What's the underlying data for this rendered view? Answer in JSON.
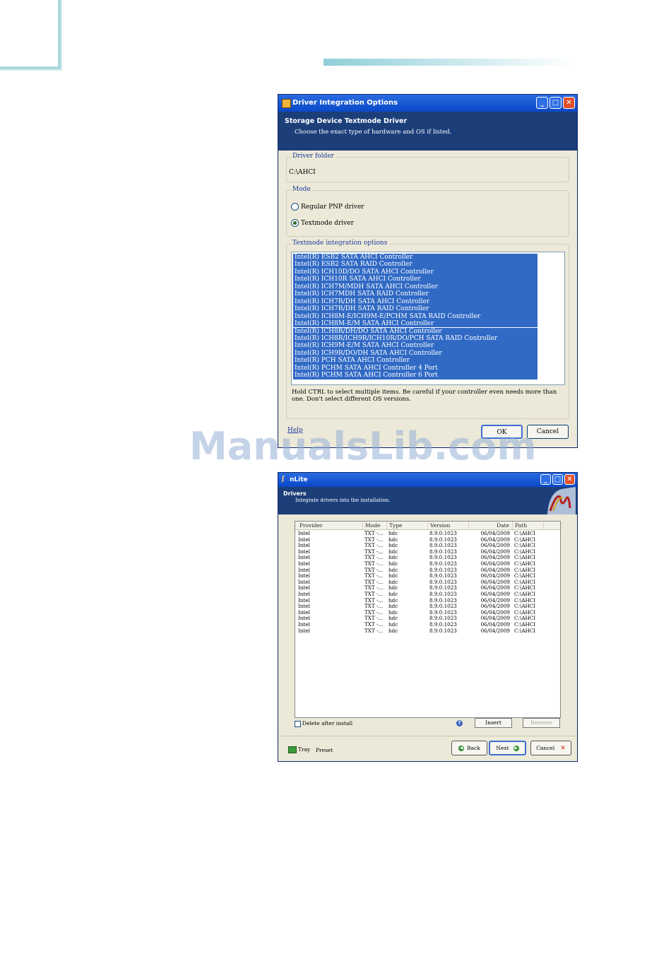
{
  "watermark": "ManualsLib.com",
  "dialog": {
    "title": "Driver Integration Options",
    "heading": "Storage Device Textmode Driver",
    "subheading": "Choose the exact type of hardware and OS if listed.",
    "driver_folder_label": "Driver folder",
    "driver_folder_value": "C:\\AHCI",
    "mode_label": "Mode",
    "mode_options": [
      "Regular PNP driver",
      "Textmode driver"
    ],
    "mode_selected": 1,
    "textmode_label": "Textmode integration options",
    "textmode_items": [
      "Intel(R) ESB2 SATA AHCI Controller",
      "Intel(R) ESB2 SATA RAID Controller",
      "Intel(R) ICH10D/DO SATA AHCI Controller",
      "Intel(R) ICH10R SATA AHCI Controller",
      "Intel(R) ICH7M/MDH SATA AHCI Controller",
      "Intel(R) ICH7MDH SATA RAID Controller",
      "Intel(R) ICH7R/DH SATA AHCI Controller",
      "Intel(R) ICH7R/DH SATA RAID Controller",
      "Intel(R) ICH8M-E/ICH9M-E/PCHM SATA RAID Controller",
      "Intel(R) ICH8M-E/M SATA AHCI Controller",
      "Intel(R) ICH8R/DH/DO SATA AHCI Controller",
      "Intel(R) ICH8R/ICH9R/ICH10R/DO/PCH SATA RAID Controller",
      "Intel(R) ICH9M-E/M SATA AHCI Controller",
      "Intel(R) ICH9R/DO/DH SATA AHCI Controller",
      "Intel(R) PCH SATA AHCI Controller",
      "Intel(R) PCHM SATA AHCI Controller 4 Port",
      "Intel(R) PCHM SATA AHCI Controller 6 Port"
    ],
    "hint": "Hold CTRL to select multiple items. Be careful if your controller even needs more than one. Don't select different OS versions.",
    "help_label": "Help",
    "ok_label": "OK",
    "cancel_label": "Cancel"
  },
  "nlite": {
    "title": "nLite",
    "heading": "Drivers",
    "subheading": "Integrate drivers into the installation.",
    "columns": [
      "Provider",
      "Mode",
      "Type",
      "Version",
      "Date",
      "Path"
    ],
    "rows": [
      [
        "Intel",
        "TXT -...",
        "hdc",
        "8.9.0.1023",
        "06/04/2009",
        "C:\\AHCI"
      ],
      [
        "Intel",
        "TXT -...",
        "hdc",
        "8.9.0.1023",
        "06/04/2009",
        "C:\\AHCI"
      ],
      [
        "Intel",
        "TXT -...",
        "hdc",
        "8.9.0.1023",
        "06/04/2009",
        "C:\\AHCI"
      ],
      [
        "Intel",
        "TXT -...",
        "hdc",
        "8.9.0.1023",
        "06/04/2009",
        "C:\\AHCI"
      ],
      [
        "Intel",
        "TXT -...",
        "hdc",
        "8.9.0.1023",
        "06/04/2009",
        "C:\\AHCI"
      ],
      [
        "Intel",
        "TXT -...",
        "hdc",
        "8.9.0.1023",
        "06/04/2009",
        "C:\\AHCI"
      ],
      [
        "Intel",
        "TXT -...",
        "hdc",
        "8.9.0.1023",
        "06/04/2009",
        "C:\\AHCI"
      ],
      [
        "Intel",
        "TXT -...",
        "hdc",
        "8.9.0.1023",
        "06/04/2009",
        "C:\\AHCI"
      ],
      [
        "Intel",
        "TXT -...",
        "hdc",
        "8.9.0.1023",
        "06/04/2009",
        "C:\\AHCI"
      ],
      [
        "Intel",
        "TXT -...",
        "hdc",
        "8.9.0.1023",
        "06/04/2009",
        "C:\\AHCI"
      ],
      [
        "Intel",
        "TXT -...",
        "hdc",
        "8.9.0.1023",
        "06/04/2009",
        "C:\\AHCI"
      ],
      [
        "Intel",
        "TXT -...",
        "hdc",
        "8.9.0.1023",
        "06/04/2009",
        "C:\\AHCI"
      ],
      [
        "Intel",
        "TXT -...",
        "hdc",
        "8.9.0.1023",
        "06/04/2009",
        "C:\\AHCI"
      ],
      [
        "Intel",
        "TXT -...",
        "hdc",
        "8.9.0.1023",
        "06/04/2009",
        "C:\\AHCI"
      ],
      [
        "Intel",
        "TXT -...",
        "hdc",
        "8.9.0.1023",
        "06/04/2009",
        "C:\\AHCI"
      ],
      [
        "Intel",
        "TXT -...",
        "hdc",
        "8.9.0.1023",
        "06/04/2009",
        "C:\\AHCI"
      ],
      [
        "Intel",
        "TXT -...",
        "hdc",
        "8.9.0.1023",
        "06/04/2009",
        "C:\\AHCI"
      ]
    ],
    "delete_after_install": "Delete after install",
    "insert_label": "Insert",
    "remove_label": "Remove",
    "tray_label": "Tray",
    "preset_label": "Preset",
    "back_label": "Back",
    "next_label": "Next",
    "cancel_label": "Cancel"
  }
}
